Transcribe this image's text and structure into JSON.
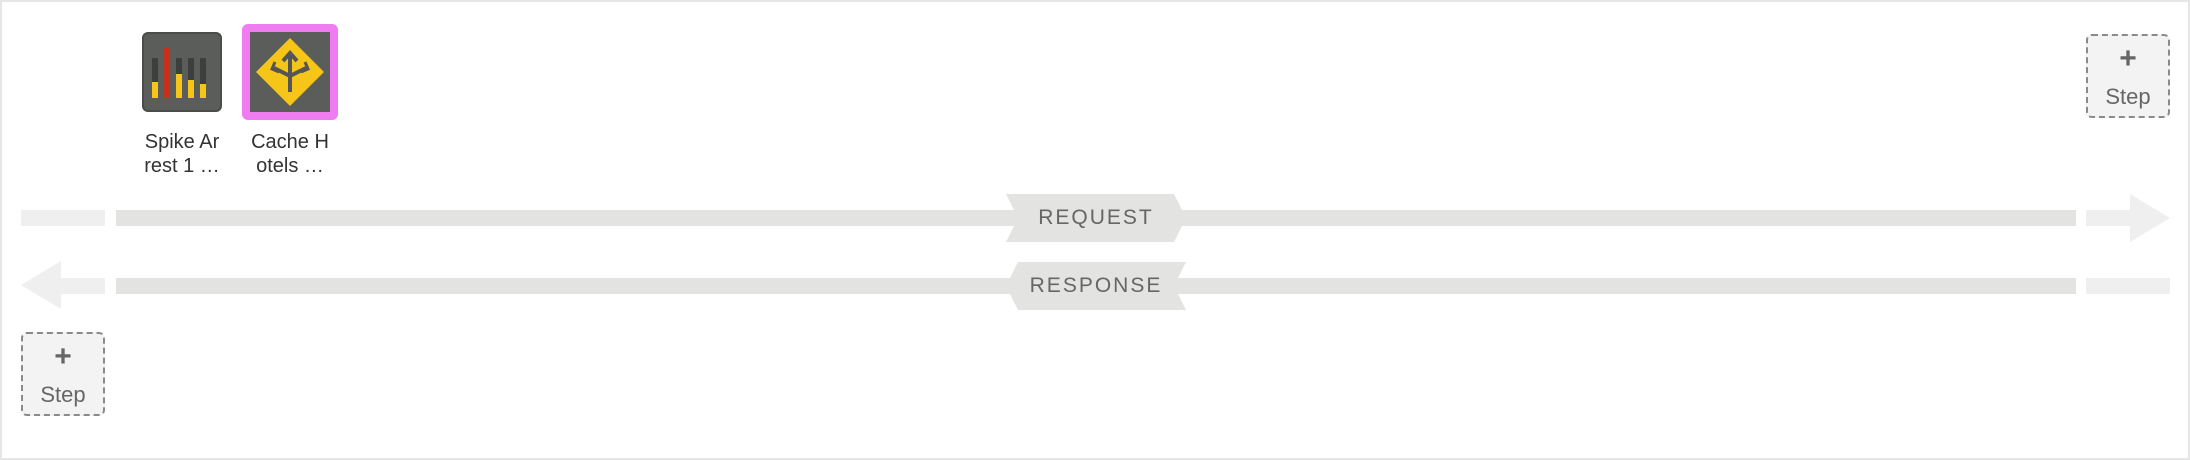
{
  "flow": {
    "request_label": "REQUEST",
    "response_label": "RESPONSE"
  },
  "add_step": {
    "plus": "+",
    "label": "Step"
  },
  "policies": [
    {
      "name": "Spike Ar\nrest 1 …",
      "icon": "spike-arrest-icon",
      "selected": false
    },
    {
      "name": "Cache H\notels …",
      "icon": "response-cache-icon",
      "selected": true
    }
  ],
  "colors": {
    "selected_border": "#f07cf2",
    "tile_bg": "#5b5d5a",
    "accent_yellow": "#f5c518",
    "accent_red": "#c9301c",
    "flow_bar": "#e3e3e1"
  }
}
